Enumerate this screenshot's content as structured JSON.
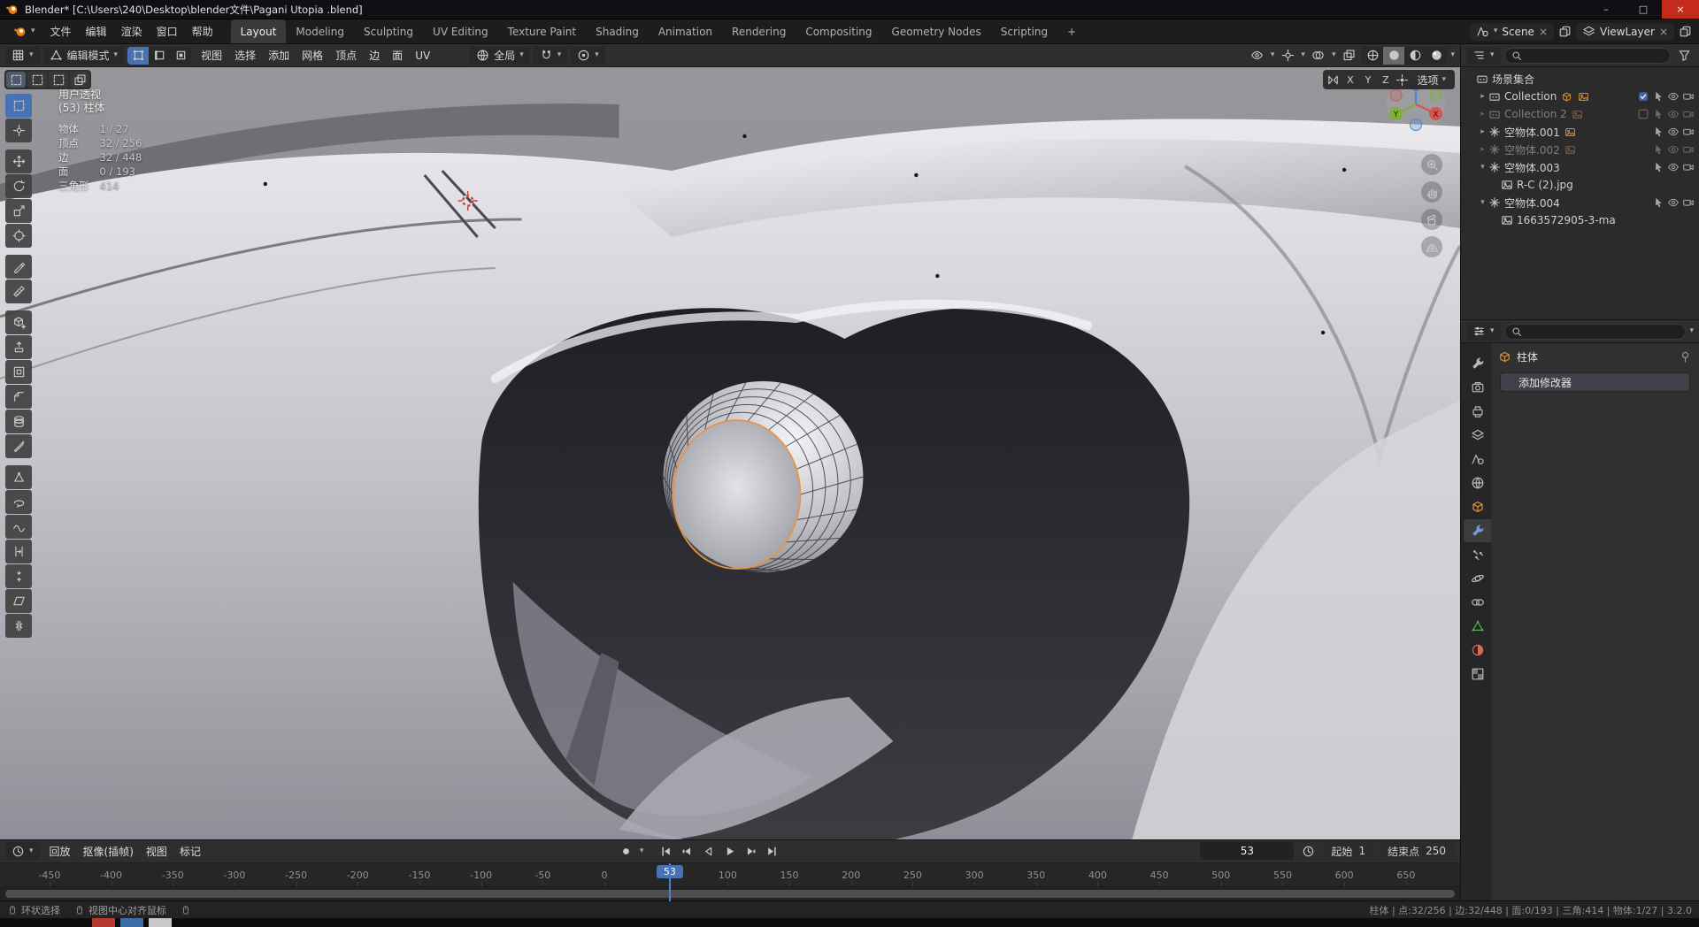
{
  "colors": {
    "accent_blue": "#4772b4",
    "accent_orange": "#e8913c",
    "close_red": "#c42b1c",
    "axis_x": "#d85450",
    "axis_y": "#7fae3a",
    "axis_z": "#4a86ca"
  },
  "titlebar": {
    "title": "Blender* [C:\\Users\\240\\Desktop\\blender文件\\Pagani Utopia .blend]"
  },
  "topbar": {
    "menus": [
      "文件",
      "编辑",
      "渲染",
      "窗口",
      "帮助"
    ],
    "workspaces": [
      "Layout",
      "Modeling",
      "Sculpting",
      "UV Editing",
      "Texture Paint",
      "Shading",
      "Animation",
      "Rendering",
      "Compositing",
      "Geometry Nodes",
      "Scripting"
    ],
    "active_workspace": "Layout",
    "add_tab": "+",
    "scene_field": {
      "value": "Scene"
    },
    "view_layer_field": {
      "value": "ViewLayer"
    }
  },
  "vp_header": {
    "mode": "编辑模式",
    "select_modes": [
      "vertex",
      "edge",
      "face"
    ],
    "active_select_mode": "vertex",
    "menus": [
      "视图",
      "选择",
      "添加",
      "网格",
      "顶点",
      "边",
      "面",
      "UV"
    ],
    "orientation": "全局",
    "shading_modes": [
      "wireframe",
      "solid",
      "material",
      "rendered"
    ],
    "active_shading": "solid"
  },
  "tool_settings": {
    "mirror_axes": [
      "X",
      "Y",
      "Z"
    ],
    "options_label": "选项"
  },
  "toolbar": {
    "active_tool": "select-box",
    "tools": [
      "select-box",
      "cursor",
      "move",
      "rotate",
      "scale",
      "transform",
      "annotate",
      "measure",
      "add-cube",
      "extrude-region",
      "inset-faces",
      "bevel",
      "loop-cut",
      "knife",
      "poly-build",
      "spin",
      "smooth",
      "edge-slide",
      "shrink-fatten",
      "shear",
      "rip-region"
    ],
    "gaps_after": [
      1,
      5,
      7,
      13
    ]
  },
  "viewport": {
    "overlay": {
      "perspective": "用户透视",
      "object": "(53) 柱体",
      "stats": [
        {
          "label": "物体",
          "value": "1 / 27"
        },
        {
          "label": "顶点",
          "value": "32 / 256"
        },
        {
          "label": "边",
          "value": "32 / 448"
        },
        {
          "label": "面",
          "value": "0 / 193"
        },
        {
          "label": "三角形",
          "value": "414"
        }
      ]
    },
    "nav_axes": [
      "X",
      "Y",
      "Z"
    ],
    "side_buttons": [
      "zoom",
      "pan",
      "camera",
      "grid"
    ]
  },
  "outliner": {
    "rows": [
      {
        "label": "场景集合",
        "icon": "collection",
        "level": 0,
        "disclosure": "none",
        "right": []
      },
      {
        "label": "Collection",
        "icon": "collection",
        "level": 1,
        "disclosure": "closed",
        "checkbox": "checked",
        "badges": [
          "object",
          "image"
        ],
        "right": [
          "checkbox",
          "pointer",
          "eye",
          "camera"
        ]
      },
      {
        "label": "Collection 2",
        "icon": "collection",
        "level": 1,
        "disclosure": "closed",
        "checkbox": "unchecked",
        "dim": true,
        "badges": [
          "image"
        ],
        "right": [
          "checkbox",
          "pointer",
          "eye",
          "camera"
        ]
      },
      {
        "label": "空物体.001",
        "icon": "empty",
        "level": 1,
        "disclosure": "closed",
        "badges": [
          "image"
        ],
        "right": [
          "pointer",
          "eye",
          "camera"
        ]
      },
      {
        "label": "空物体.002",
        "icon": "empty",
        "level": 1,
        "disclosure": "closed",
        "dim": true,
        "badges": [
          "image"
        ],
        "right": [
          "pointer",
          "eye",
          "camera"
        ]
      },
      {
        "label": "空物体.003",
        "icon": "empty",
        "level": 1,
        "disclosure": "open",
        "badges": [],
        "right": [
          "pointer",
          "eye",
          "camera"
        ]
      },
      {
        "label": "R-C (2).jpg",
        "icon": "image",
        "level": 2,
        "disclosure": "none",
        "right": []
      },
      {
        "label": "空物体.004",
        "icon": "empty",
        "level": 1,
        "disclosure": "open",
        "badges": [],
        "right": [
          "pointer",
          "eye",
          "camera"
        ]
      },
      {
        "label": "1663572905-3-ma",
        "icon": "image",
        "level": 2,
        "disclosure": "none",
        "right": []
      }
    ]
  },
  "properties": {
    "tabs": [
      {
        "name": "tool"
      },
      {
        "name": "render"
      },
      {
        "name": "output"
      },
      {
        "name": "view-layer"
      },
      {
        "name": "scene"
      },
      {
        "name": "world"
      },
      {
        "name": "object",
        "color": "orange"
      },
      {
        "name": "modifiers",
        "active": true,
        "color": "blue"
      },
      {
        "name": "particles"
      },
      {
        "name": "physics"
      },
      {
        "name": "constraints"
      },
      {
        "name": "data",
        "color": "green"
      },
      {
        "name": "material",
        "color": "red"
      },
      {
        "name": "texture"
      }
    ],
    "breadcrumb": {
      "object": "柱体"
    },
    "add_modifier": "添加修改器"
  },
  "timeline": {
    "menus": [
      "回放",
      "抠像(插帧)",
      "视图",
      "标记"
    ],
    "transport": [
      "jump-first",
      "prev-key",
      "play-reverse",
      "play",
      "next-key",
      "jump-last"
    ],
    "current_frame": 53,
    "frame_display": "53",
    "start": {
      "label": "起始",
      "value": "1"
    },
    "end": {
      "label": "结束点",
      "value": "250"
    },
    "ticks": [
      -450,
      -400,
      -350,
      -300,
      -250,
      -200,
      -150,
      -100,
      -50,
      0,
      100,
      150,
      200,
      250,
      300,
      350,
      400,
      450,
      500,
      550,
      600,
      650
    ]
  },
  "statusbar": {
    "hints": [
      "环状选择",
      "视图中心对齐鼠标"
    ],
    "stats": "柱体 | 点:32/256 | 边:32/448 | 面:0/193 | 三角:414 | 物体:1/27 | 3.2.0"
  }
}
